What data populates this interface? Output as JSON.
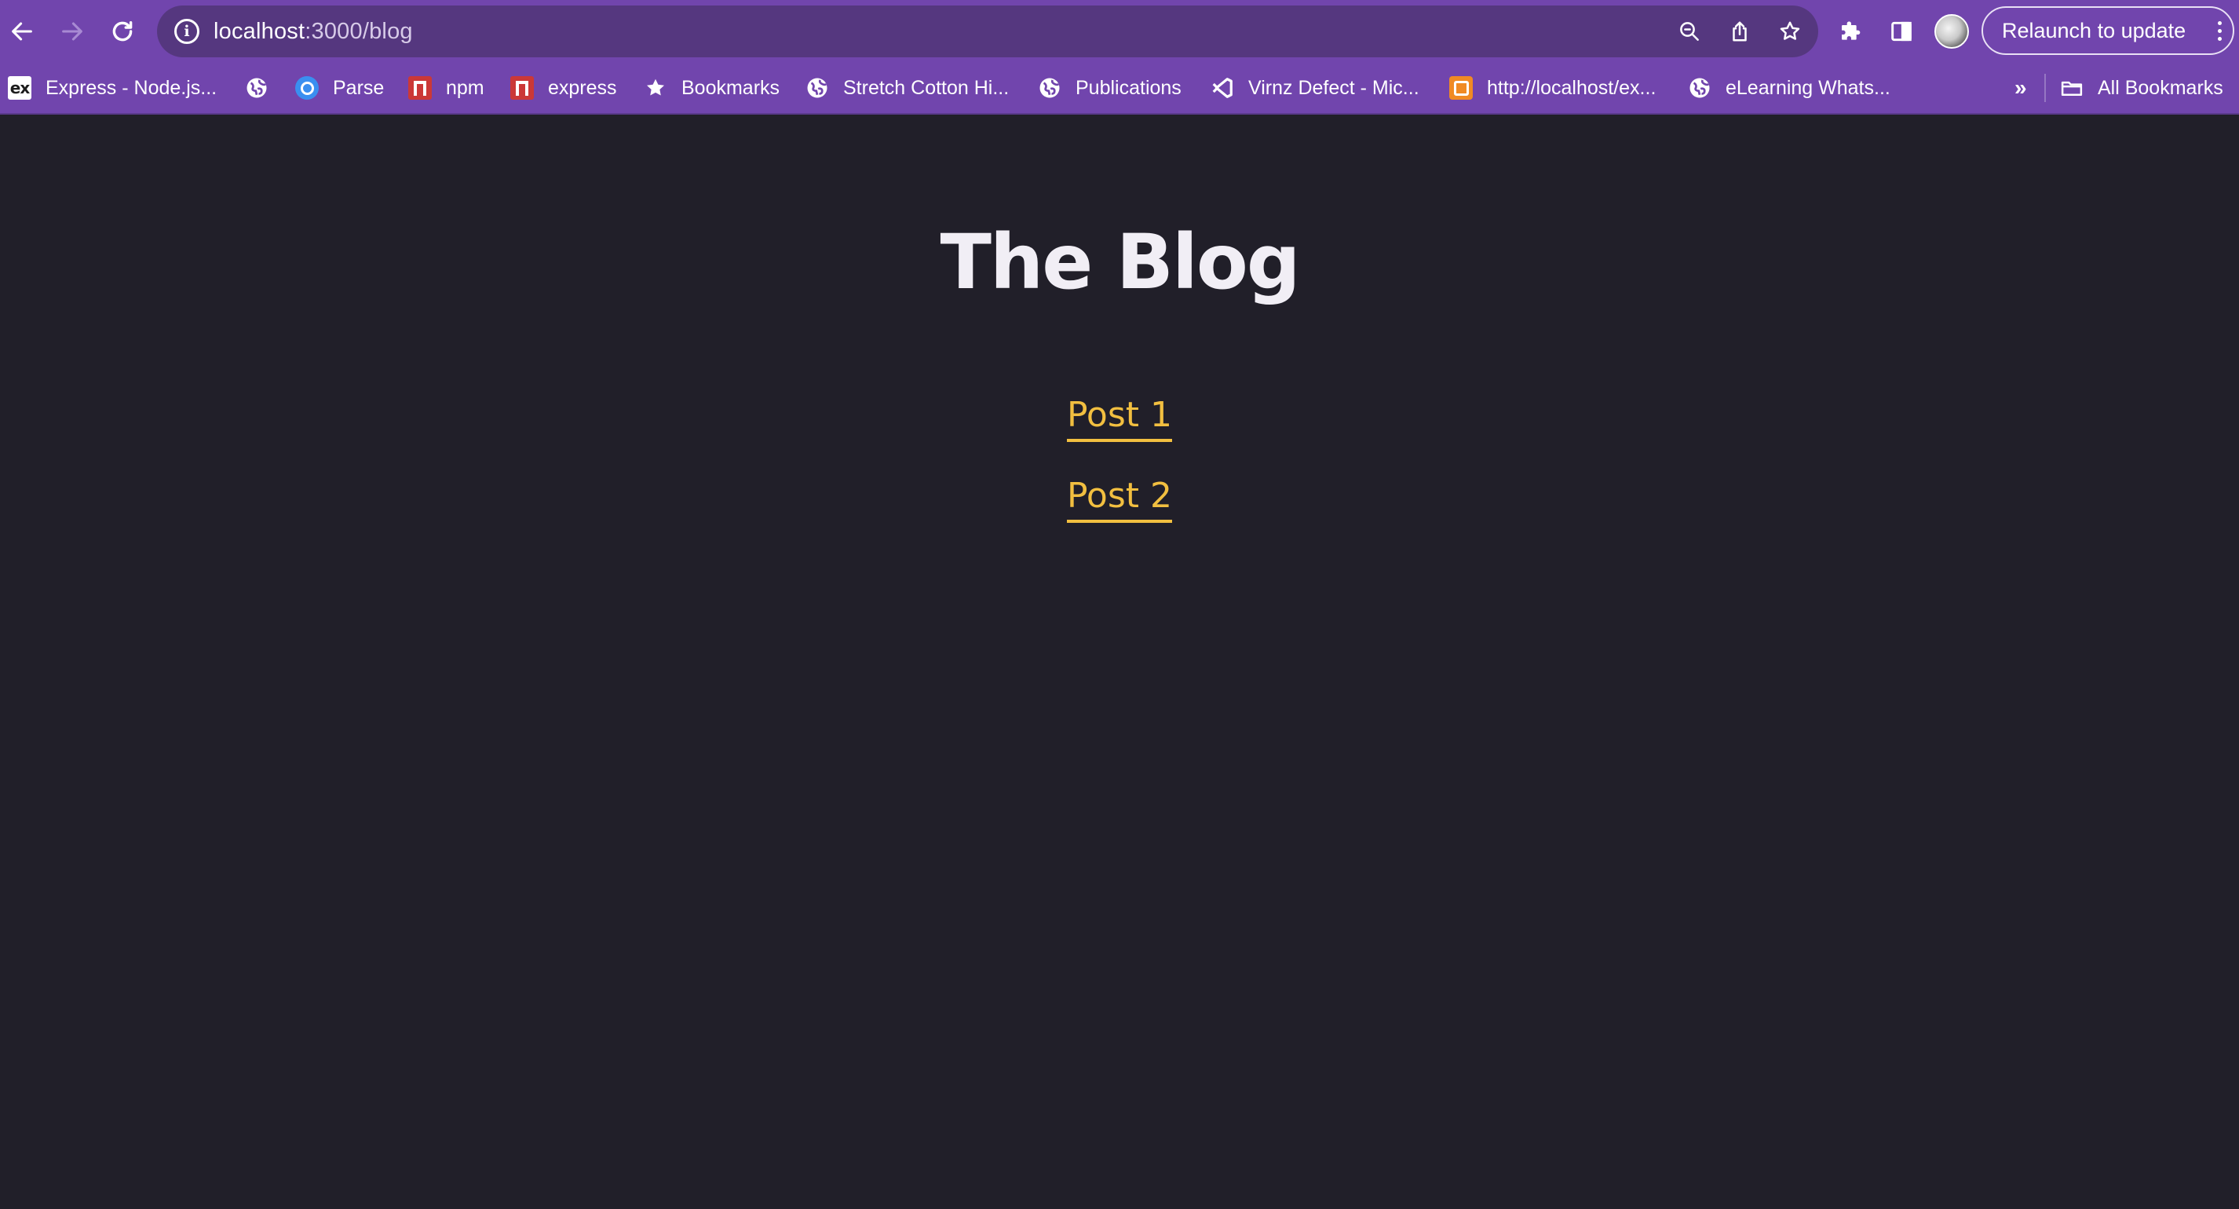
{
  "browser": {
    "url_host": "localhost",
    "url_path": ":3000/blog",
    "relaunch_label": "Relaunch to update",
    "bookmarks": [
      {
        "label": "Express - Node.js...",
        "icon": "express-icon"
      },
      {
        "label": "",
        "icon": "globe-icon"
      },
      {
        "label": "Parse",
        "icon": "parse-icon"
      },
      {
        "label": "npm",
        "icon": "npm-icon"
      },
      {
        "label": "express",
        "icon": "npm-icon"
      },
      {
        "label": "Bookmarks",
        "icon": "star-icon"
      },
      {
        "label": "Stretch Cotton Hi...",
        "icon": "globe-icon"
      },
      {
        "label": "Publications",
        "icon": "globe-icon"
      },
      {
        "label": "Virnz Defect - Mic...",
        "icon": "visual-studio-icon"
      },
      {
        "label": "http://localhost/ex...",
        "icon": "xampp-icon"
      },
      {
        "label": "eLearning Whats...",
        "icon": "globe-icon"
      }
    ],
    "overflow_label": "»",
    "all_bookmarks_label": "All Bookmarks"
  },
  "page": {
    "title": "The Blog",
    "posts": [
      {
        "label": "Post 1"
      },
      {
        "label": "Post 2"
      }
    ]
  },
  "colors": {
    "chrome": "#7145ad",
    "omnibox": "#55377f",
    "background": "#211f29",
    "title": "#f1eef5",
    "link": "#f2bf40"
  }
}
